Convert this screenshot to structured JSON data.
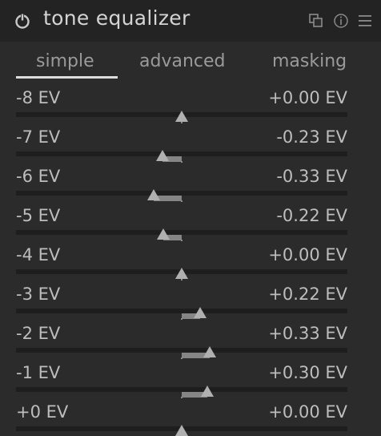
{
  "module": {
    "title": "tone equalizer",
    "icons": {
      "power": "power-icon",
      "multi_instance": "multi-instance-icon",
      "reset": "reset-icon",
      "presets": "presets-menu-icon"
    }
  },
  "tabs": [
    {
      "label": "simple",
      "active": true
    },
    {
      "label": "advanced",
      "active": false
    },
    {
      "label": "masking",
      "active": false
    }
  ],
  "sliders": [
    {
      "label": "-8 EV",
      "value_text": "+0.00 EV",
      "value": 0.0
    },
    {
      "label": "-7 EV",
      "value_text": "-0.23 EV",
      "value": -0.23
    },
    {
      "label": "-6 EV",
      "value_text": "-0.33 EV",
      "value": -0.33
    },
    {
      "label": "-5 EV",
      "value_text": "-0.22 EV",
      "value": -0.22
    },
    {
      "label": "-4 EV",
      "value_text": "+0.00 EV",
      "value": 0.0
    },
    {
      "label": "-3 EV",
      "value_text": "+0.22 EV",
      "value": 0.22
    },
    {
      "label": "-2 EV",
      "value_text": "+0.33 EV",
      "value": 0.33
    },
    {
      "label": "-1 EV",
      "value_text": "+0.30 EV",
      "value": 0.3
    },
    {
      "label": "+0 EV",
      "value_text": "+0.00 EV",
      "value": 0.0
    }
  ],
  "colors": {
    "background": "#2b2b2b",
    "header": "#232323",
    "track": "#1e1e1e",
    "fill": "#858585",
    "thumb": "#b0b0b0",
    "text": "#bdbdbd"
  }
}
